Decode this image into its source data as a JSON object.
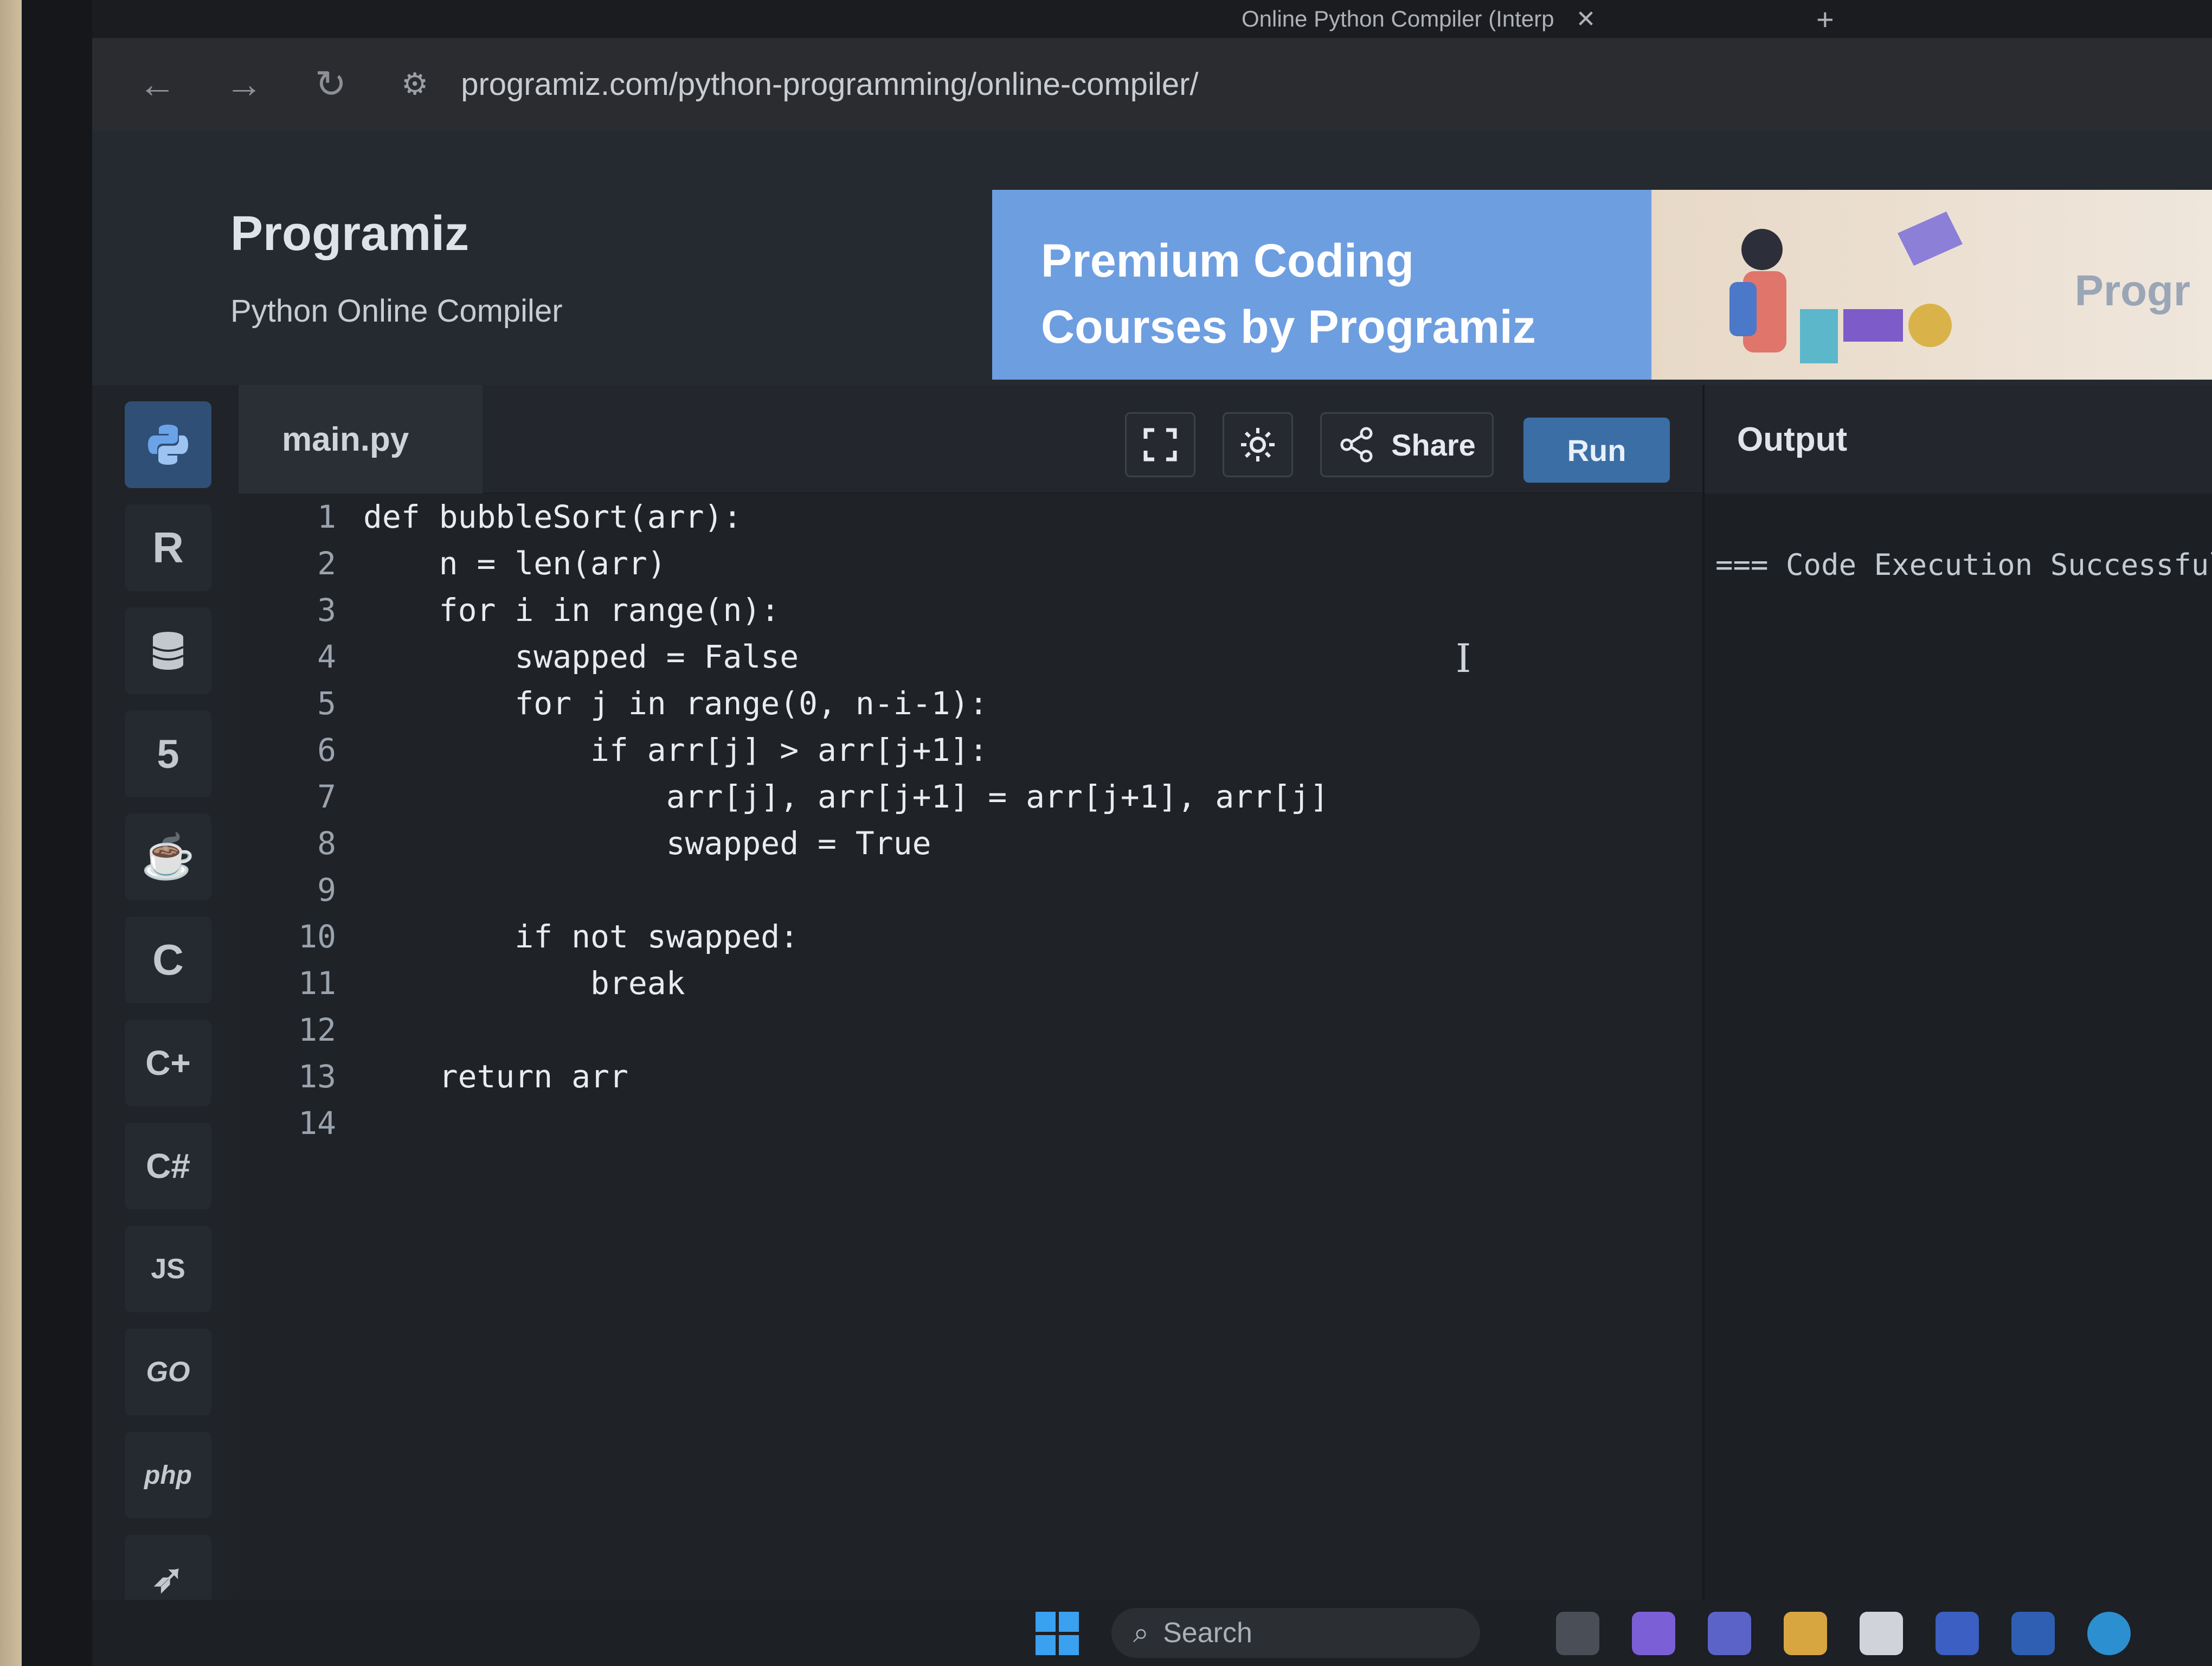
{
  "browser": {
    "tab_title": "Online Python Compiler (Interp",
    "tab_close": "✕",
    "new_tab": "+",
    "url": "programiz.com/python-programming/online-compiler/"
  },
  "header": {
    "logo": "Programiz",
    "subtitle": "Python Online Compiler",
    "banner_line1": "Premium Coding",
    "banner_line2": "Courses by Programiz",
    "banner_brand": "Progr"
  },
  "sidebar": {
    "js_label": "JS",
    "go_label": "GO",
    "php_label": "php"
  },
  "toolbar": {
    "file_name": "main.py",
    "share_label": "Share",
    "run_label": "Run"
  },
  "editor": {
    "lines": [
      {
        "n": "1",
        "text": "def bubbleSort(arr):"
      },
      {
        "n": "2",
        "text": "    n = len(arr)"
      },
      {
        "n": "3",
        "text": "    for i in range(n):"
      },
      {
        "n": "4",
        "text": "        swapped = False"
      },
      {
        "n": "5",
        "text": "        for j in range(0, n-i-1):"
      },
      {
        "n": "6",
        "text": "            if arr[j] > arr[j+1]:"
      },
      {
        "n": "7",
        "text": "                arr[j], arr[j+1] = arr[j+1], arr[j]"
      },
      {
        "n": "8",
        "text": "                swapped = True"
      },
      {
        "n": "9",
        "text": ""
      },
      {
        "n": "10",
        "text": "        if not swapped:"
      },
      {
        "n": "11",
        "text": "            break"
      },
      {
        "n": "12",
        "text": ""
      },
      {
        "n": "13",
        "text": "    return arr"
      },
      {
        "n": "14",
        "text": ""
      }
    ]
  },
  "output": {
    "title": "Output",
    "text": "=== Code Execution Successful ==="
  },
  "taskbar": {
    "search_label": "Search"
  },
  "colors": {
    "accent": "#3b6ea5",
    "banner_blue": "#6d9ee0",
    "editor_bg": "#1f2227"
  }
}
